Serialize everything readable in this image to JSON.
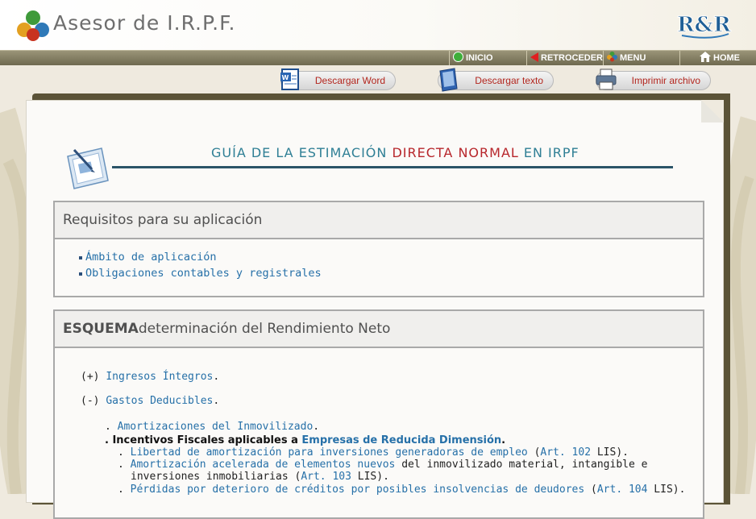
{
  "header": {
    "app_title": "Asesor de I.R.P.F.",
    "brand": "R&R"
  },
  "nav": {
    "inicio": "INICIO",
    "retroceder": "RETROCEDER",
    "menu": "MENU",
    "home": "HOME"
  },
  "actions": {
    "word": "Descargar Word",
    "text": "Descargar texto",
    "print": "Imprimir archivo"
  },
  "guide": {
    "title_part1": "GUÍA DE LA ESTIMACIÓN ",
    "title_highlight": "DIRECTA NORMAL",
    "title_part2": " EN IRPF"
  },
  "requisitos": {
    "heading": "Requisitos para su aplicación",
    "items": [
      "Ámbito de aplicación",
      "Obligaciones contables y registrales"
    ]
  },
  "esquema": {
    "heading_bold": "ESQUEMA",
    "heading_rest": " determinación del Rendimiento Neto",
    "ingresos_sign": "(+)",
    "ingresos_link": "Ingresos Íntegros",
    "gastos_sign": "(-)",
    "gastos_link": "Gastos Deducibles",
    "amortizaciones": "Amortizaciones del Inmovilizado",
    "incentivos_bold": "Incentivos Fiscales aplicables a ",
    "incentivos_link": "Empresas de Reducida Dimensión",
    "libertad_link": "Libertad de amortización para inversiones generadoras de empleo",
    "libertad_art": "Art. 102",
    "acelerada_link": "Amortización acelerada de elementos nuevos",
    "acelerada_rest1": " del inmovilizado material, intangible e",
    "acelerada_rest2": "inversiones inmobiliarias (",
    "acelerada_art": "Art. 103",
    "perdidas_link": "Pérdidas por deterioro de créditos por posibles insolvencias de deudores",
    "perdidas_art": "Art. 104",
    "lis": " LIS)."
  }
}
